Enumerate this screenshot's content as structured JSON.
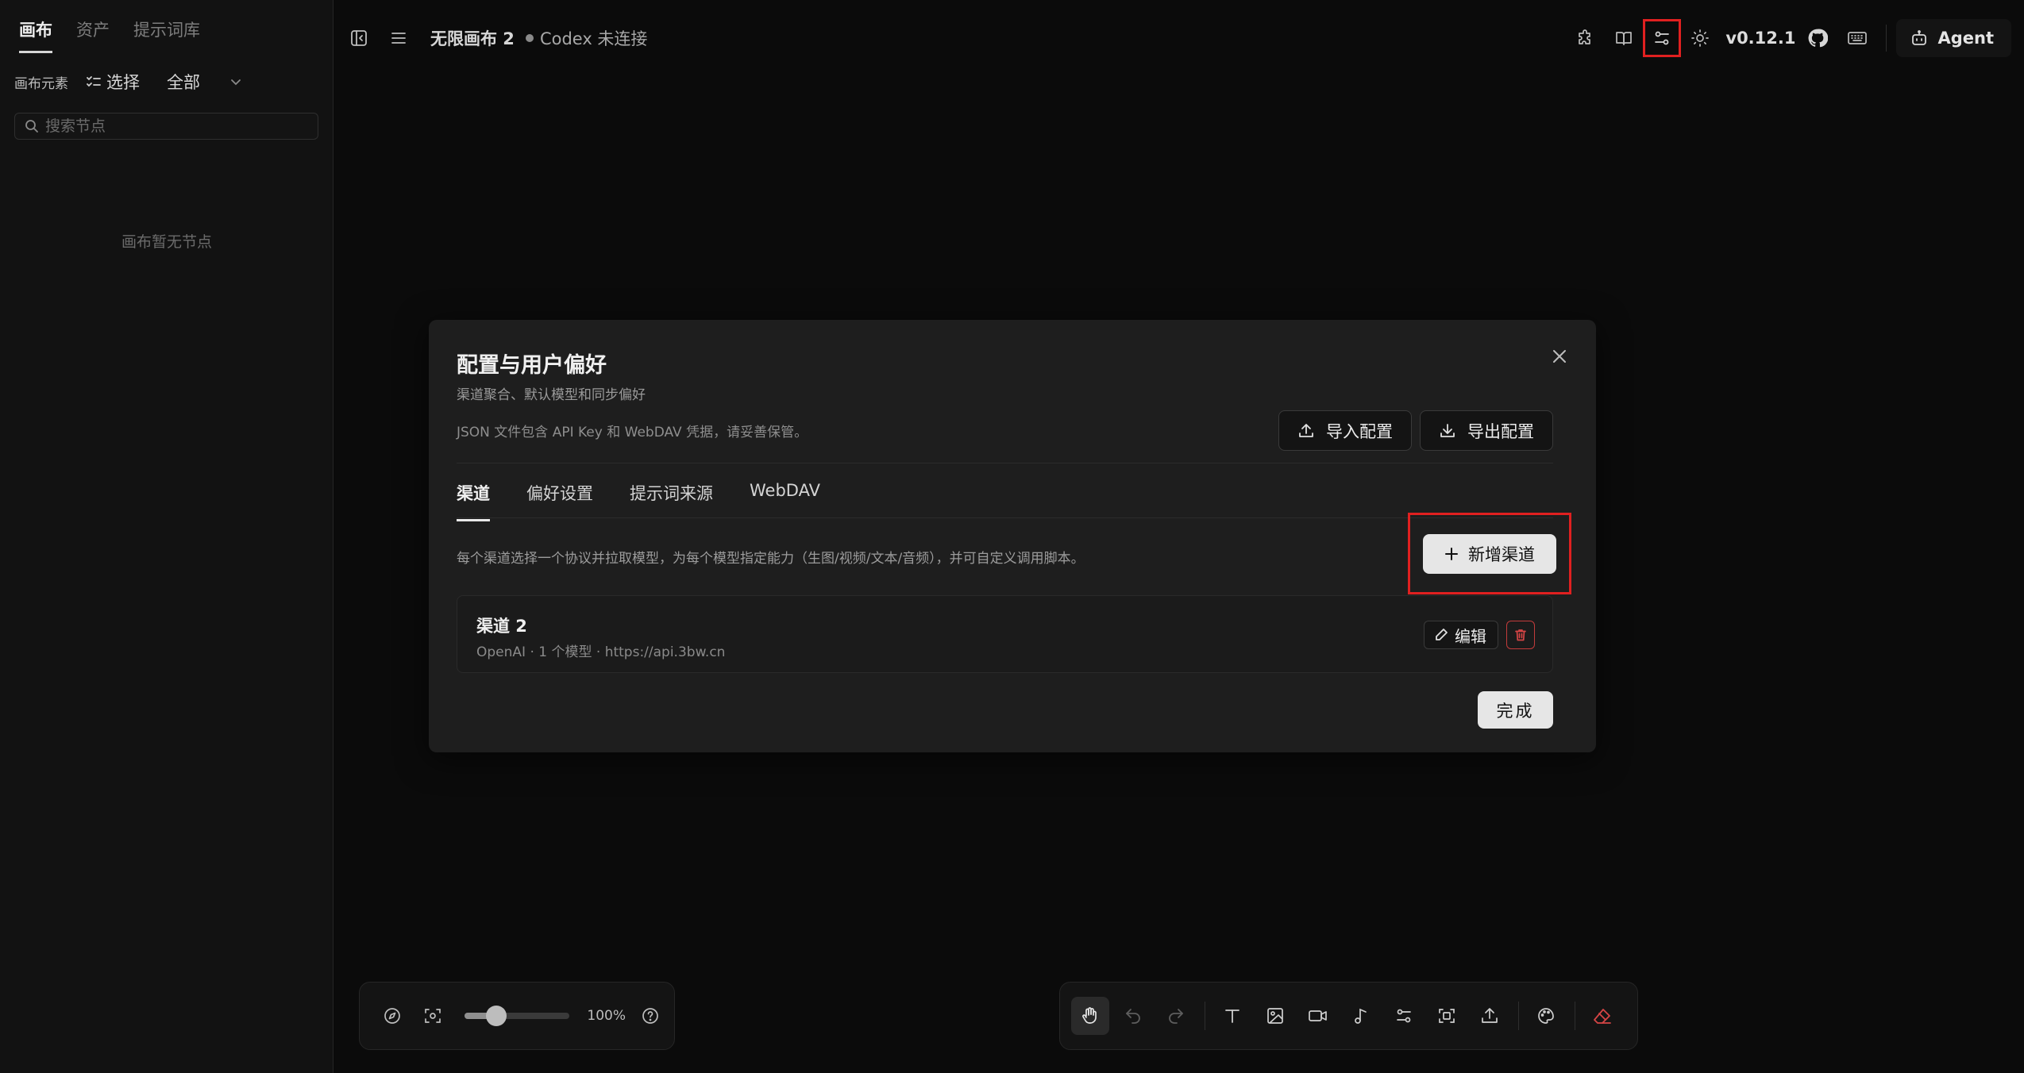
{
  "sidebar": {
    "tabs": [
      "画布",
      "资产",
      "提示词库"
    ],
    "elements_label": "画布元素",
    "select_label": "选择",
    "filter_label": "全部",
    "search_placeholder": "搜索节点",
    "empty_text": "画布暂无节点"
  },
  "topbar": {
    "title": "无限画布 2",
    "status": "Codex 未连接",
    "version": "v0.12.1",
    "agent_label": "Agent",
    "icons": [
      "panel-toggle-icon",
      "menu-icon",
      "plugin-icon",
      "book-icon",
      "settings-sliders-icon",
      "sun-icon",
      "github-icon",
      "keyboard-icon",
      "bot-icon"
    ]
  },
  "modal": {
    "title": "配置与用户偏好",
    "subtitle": "渠道聚合、默认模型和同步偏好",
    "note": "JSON 文件包含 API Key 和 WebDAV 凭据，请妥善保管。",
    "import_label": "导入配置",
    "export_label": "导出配置",
    "tabs": [
      "渠道",
      "偏好设置",
      "提示词来源",
      "WebDAV"
    ],
    "description": "每个渠道选择一个协议并拉取模型，为每个模型指定能力（生图/视频/文本/音频），并可自定义调用脚本。",
    "add_label": "新增渠道",
    "channels": [
      {
        "name": "渠道 2",
        "meta": "OpenAI · 1 个模型 · https://api.3bw.cn",
        "edit_label": "编辑"
      }
    ],
    "done_label": "完成"
  },
  "zoom": {
    "value": 0.3,
    "label": "100%"
  },
  "toolbar": {
    "tools": [
      "hand-icon",
      "undo-icon",
      "redo-icon",
      "text-icon",
      "image-icon",
      "video-icon",
      "audio-icon",
      "workflow-icon",
      "capture-icon",
      "upload-icon",
      "palette-icon",
      "eraser-icon"
    ]
  },
  "colors": {
    "highlight": "#e02020",
    "danger": "#d64545",
    "background": "#0b0b0b",
    "panel": "#1e1e1e"
  }
}
